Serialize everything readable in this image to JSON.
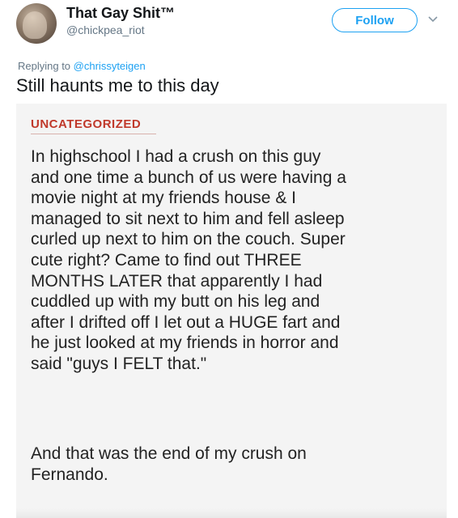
{
  "tweet": {
    "display_name": "That Gay Shit™",
    "username": "@chickpea_riot",
    "follow_label": "Follow",
    "replying_prefix": "Replying to",
    "replying_handle": "@chrissyteigen",
    "text": "Still haunts me to this day"
  },
  "card": {
    "category": "UNCATEGORIZED",
    "story_lines": [
      "In highschool I had a crush on this guy",
      "and one time a bunch of us were having a",
      "movie night at my friends house & I",
      "managed to sit next to him and fell asleep",
      "curled up next to him on the couch. Super",
      "cute right? Came to find out THREE",
      "MONTHS LATER that apparently I had",
      "cuddled up with my butt on his leg and",
      "after I drifted off I let out a HUGE fart and",
      "he just looked at my friends in horror and",
      "said \"guys I FELT that.\""
    ],
    "ending_lines": [
      "And that was the end of my crush on",
      "Fernando."
    ]
  },
  "colors": {
    "accent": "#1da1f2",
    "category": "#c0392b",
    "muted": "#657786"
  },
  "icons": {
    "chevron": "chevron-down-icon",
    "avatar": "avatar"
  }
}
